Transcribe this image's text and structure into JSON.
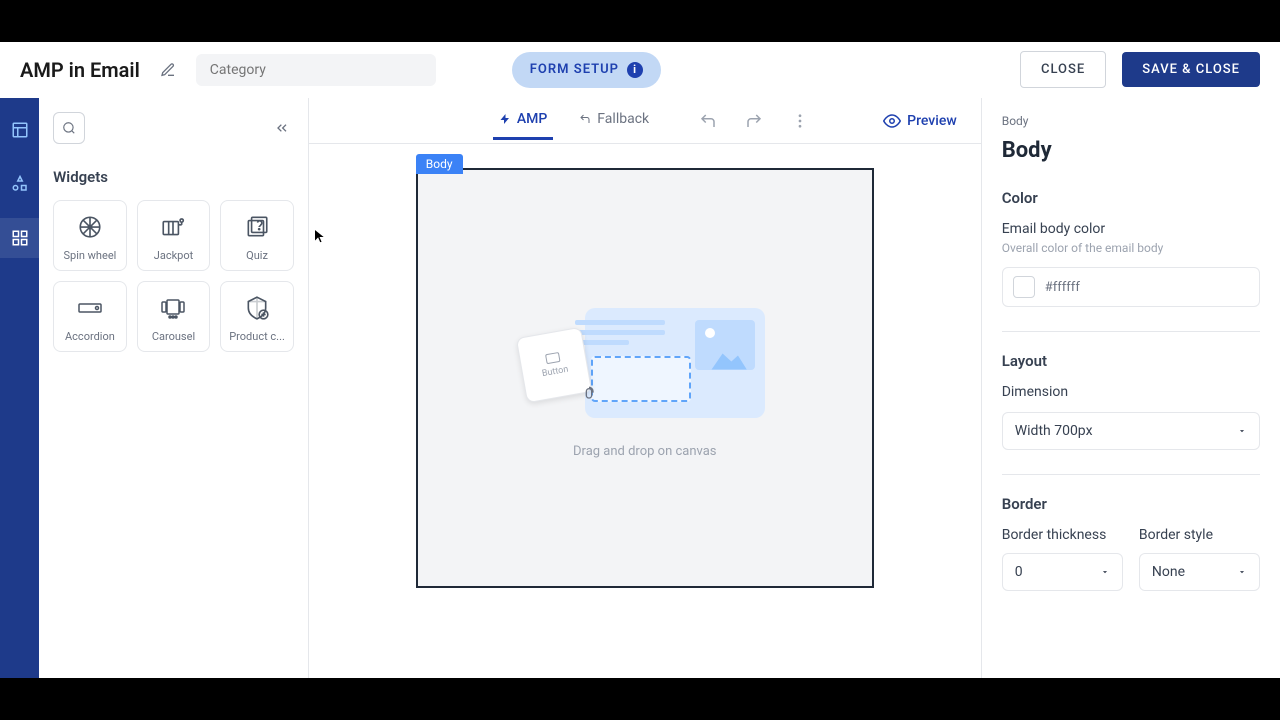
{
  "topbar": {
    "title": "AMP in Email",
    "category_placeholder": "Category",
    "form_setup": "FORM SETUP",
    "close": "CLOSE",
    "save": "SAVE & CLOSE"
  },
  "widgets": {
    "title": "Widgets",
    "items": [
      {
        "label": "Spin wheel"
      },
      {
        "label": "Jackpot"
      },
      {
        "label": "Quiz"
      },
      {
        "label": "Accordion"
      },
      {
        "label": "Carousel"
      },
      {
        "label": "Product c..."
      }
    ]
  },
  "canvas": {
    "tabs": {
      "amp": "AMP",
      "fallback": "Fallback"
    },
    "preview": "Preview",
    "body_tag": "Body",
    "placeholder_button": "Button",
    "drop_text": "Drag and drop on canvas"
  },
  "props": {
    "breadcrumb": "Body",
    "title": "Body",
    "color_section": "Color",
    "color_label": "Email body color",
    "color_hint": "Overall color of the email body",
    "color_value": "#ffffff",
    "layout_section": "Layout",
    "dimension_label": "Dimension",
    "dimension_value": "Width 700px",
    "border_section": "Border",
    "border_thickness_label": "Border thickness",
    "border_thickness_value": "0",
    "border_style_label": "Border style",
    "border_style_value": "None"
  }
}
